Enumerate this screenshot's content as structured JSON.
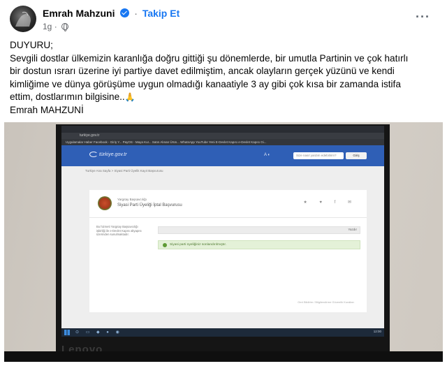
{
  "post": {
    "author": "Emrah Mahzuni",
    "follow_label": "Takip Et",
    "time": "1g",
    "separator": "·",
    "more_glyph": "···",
    "lines": [
      "DUYURU;",
      "Sevgili dostlar ülkemizin karanlığa doğru gittiği şu dönemlerde, bir umutla Partinin ve çok hatırlı",
      "bir dostun ısrarı  üzerine iyi partiye davet edilmiştim, ancak olayların gerçek yüzünü ve kendi",
      "kimliğime ve dünya görüşüme uygun olmadığı kanaatiyle 3 ay gibi çok kısa bir zamanda istifa",
      "ettim, dostlarımın bilgisine..",
      "Emrah MAHZUNİ"
    ],
    "emoji_glyph": "🙏"
  },
  "photo": {
    "browser": {
      "url": "turkiye.gov.tr",
      "bookmarks": "Uygulamalar   Haber   Facebook - Giriş Y...   PayOS - Maya Kur...   Satın Alınan Ürün...   WhatsApp   YouTube   Yeni E-Devlet Kapısı   e-Devlet Kapısı Gi..."
    },
    "site": {
      "logo": "türkiye.gov.tr",
      "search_placeholder": "Size nasıl yardım edebilirim?",
      "login_label": "Giriş",
      "breadcrumb": "Turkiye Ana Sayfa  >  Siyasi Parti Üyelik Kayıt Başvurusu",
      "header_icons": "A   ◐"
    },
    "card": {
      "org": "Yargıtay Başsavcılığı",
      "title": "Siyasi Parti Üyeliği İptal Başvurusu",
      "actions": "★ ♥ f ✉",
      "side_text": "Bu hizmeti Yargıtay Başsavcılığı işbirliği ile e-Devlet Kapısı altyapısı üzerinden sunulmaktadır.",
      "print_label": "Yazdır",
      "success_message": "Siyasi parti üyeliğiniz sonlandırılmıştır.",
      "footnote": "Geri Bildirim / Bilgilendirme Güvenlik Kuralları"
    },
    "taskbar": {
      "icons": "⊙ ▭ ◆ ● ◉",
      "clock": "12:00"
    },
    "monitor_brand": "Lenovo"
  }
}
